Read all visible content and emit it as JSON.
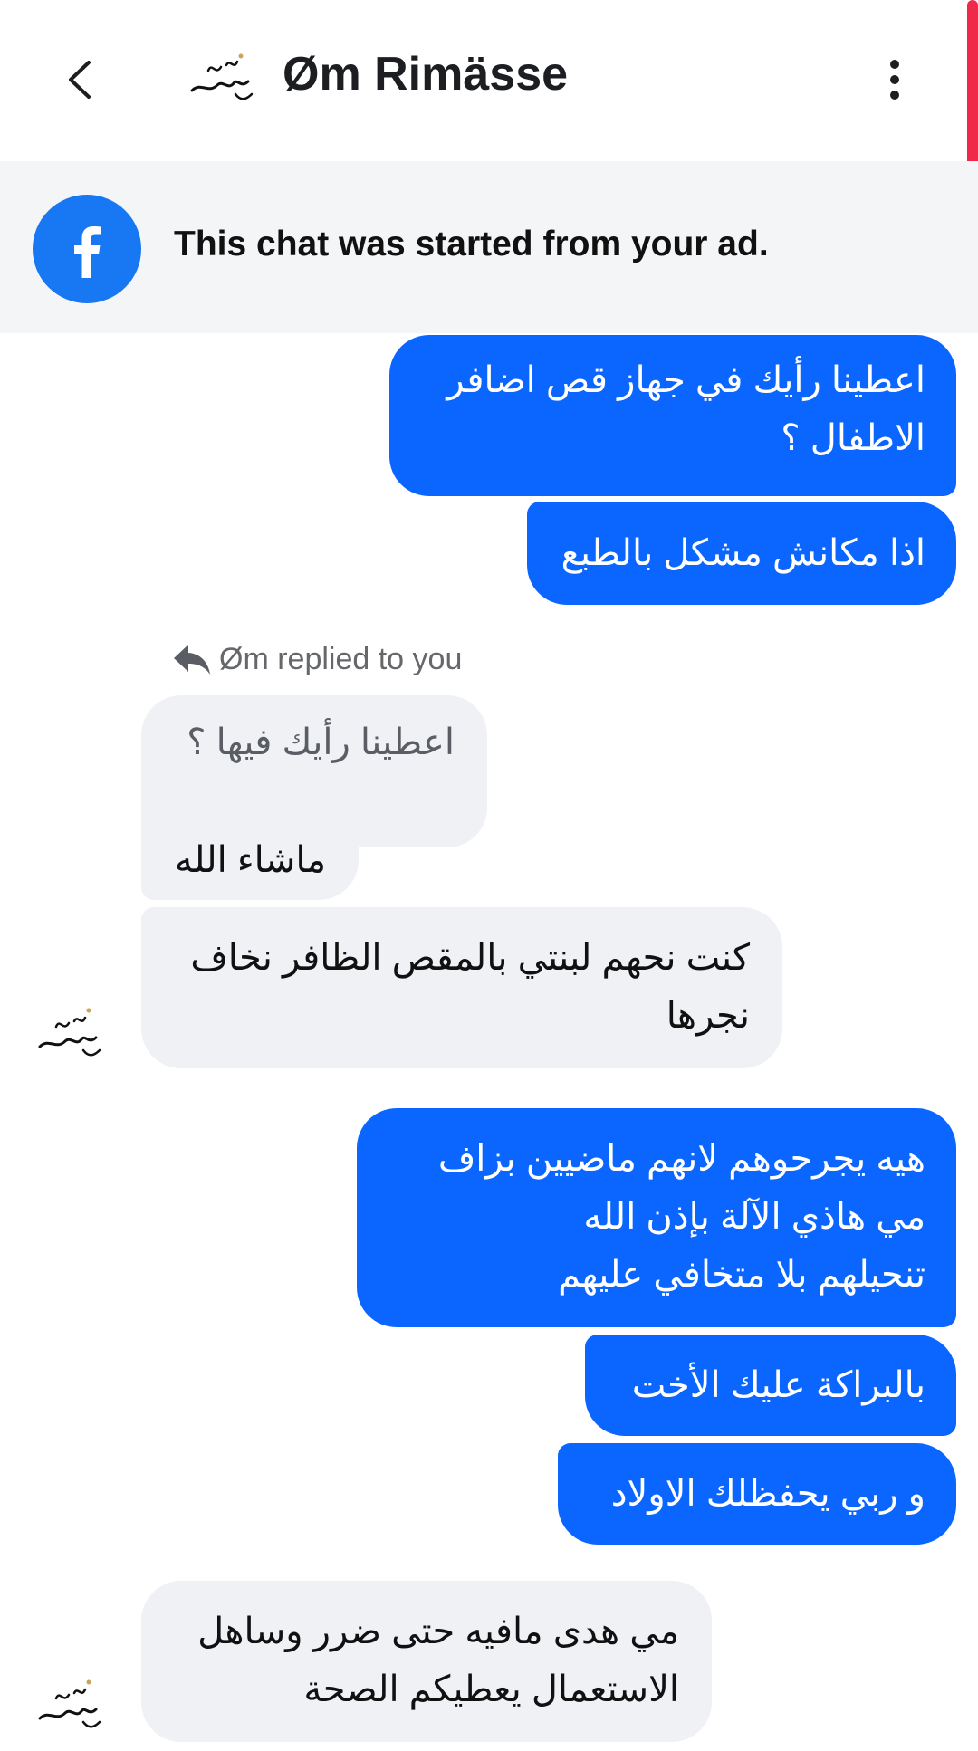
{
  "header": {
    "title": "Øm Rimässe",
    "back_icon": "chevron-left-icon",
    "more_icon": "vertical-dots-icon"
  },
  "ad_banner": {
    "text": "This chat was started from your ad.",
    "icon": "facebook-icon",
    "brand_color": "#1877f2"
  },
  "messages": [
    {
      "direction": "outgoing",
      "text": "اعطينا رأيك في جهاز قص اضافر\nالاطفال ؟"
    },
    {
      "direction": "outgoing",
      "text": "اذا مكانش مشكل بالطبع"
    },
    {
      "direction": "incoming",
      "reply_label": "Øm replied to you",
      "quoted_text": "اعطينا رأيك فيها ؟",
      "text": "ماشاء الله"
    },
    {
      "direction": "incoming",
      "text": "كنت نحهم لبنتي بالمقص الظافر نخاف\nنجرها"
    },
    {
      "direction": "outgoing",
      "text": "هيه يجرحوهم لانهم ماضيين بزاف\nمي هاذي الآلة بإذن الله\nتنحيلهم بلا متخافي عليهم"
    },
    {
      "direction": "outgoing",
      "text": "بالبراكة عليك الأخت"
    },
    {
      "direction": "outgoing",
      "text": "و ربي يحفظلك الاولاد"
    },
    {
      "direction": "incoming",
      "text": "مي هدى مافيه حتى ضرر وساهل\nالاستعمال يعطيكم الصحة"
    }
  ],
  "colors": {
    "outgoing_bubble": "#0a66ff",
    "incoming_bubble": "#eff1f5",
    "banner_bg": "#f4f5f7"
  }
}
